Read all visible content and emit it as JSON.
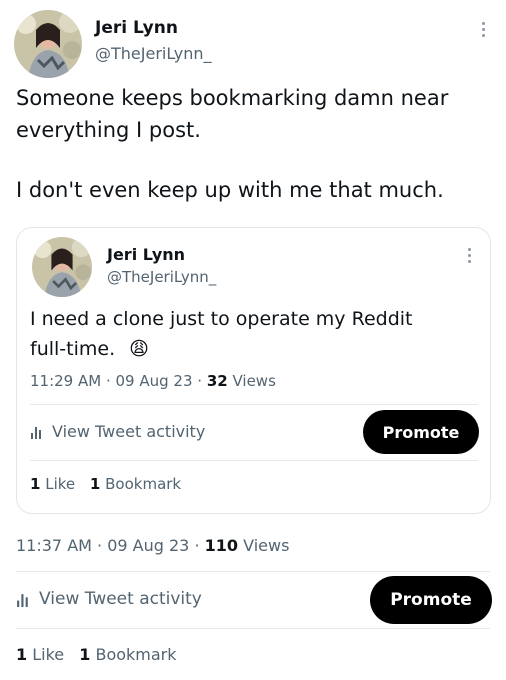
{
  "main_tweet": {
    "author_name": "Jeri Lynn",
    "author_handle": "@TheJeriLynn_",
    "text_line1": "Someone keeps bookmarking damn near",
    "text_line2": "everything I post.",
    "text_line3": "I don't even keep up with me that much.",
    "time": "11:37 AM",
    "date": "09 Aug 23",
    "views_count": "110",
    "views_label": "Views",
    "activity_label": "View Tweet activity",
    "promote_label": "Promote",
    "likes_count": "1",
    "likes_label": "Like",
    "bookmarks_count": "1",
    "bookmarks_label": "Bookmark"
  },
  "quoted_tweet": {
    "author_name": "Jeri Lynn",
    "author_handle": "@TheJeriLynn_",
    "text_line1": "I need a clone just to operate my Reddit",
    "text_line2": "full-time.",
    "emoji": "😩",
    "time": "11:29 AM",
    "date": "09 Aug 23",
    "views_count": "32",
    "views_label": "Views",
    "activity_label": "View Tweet activity",
    "promote_label": "Promote",
    "likes_count": "1",
    "likes_label": "Like",
    "bookmarks_count": "1",
    "bookmarks_label": "Bookmark"
  },
  "icons": {
    "avatar": "avatar",
    "more": "more-options-icon",
    "activity": "bar-chart-icon"
  },
  "colors": {
    "text_primary": "#0f1419",
    "text_secondary": "#536471",
    "button_bg": "#000000",
    "divider": "#e7eaec"
  }
}
